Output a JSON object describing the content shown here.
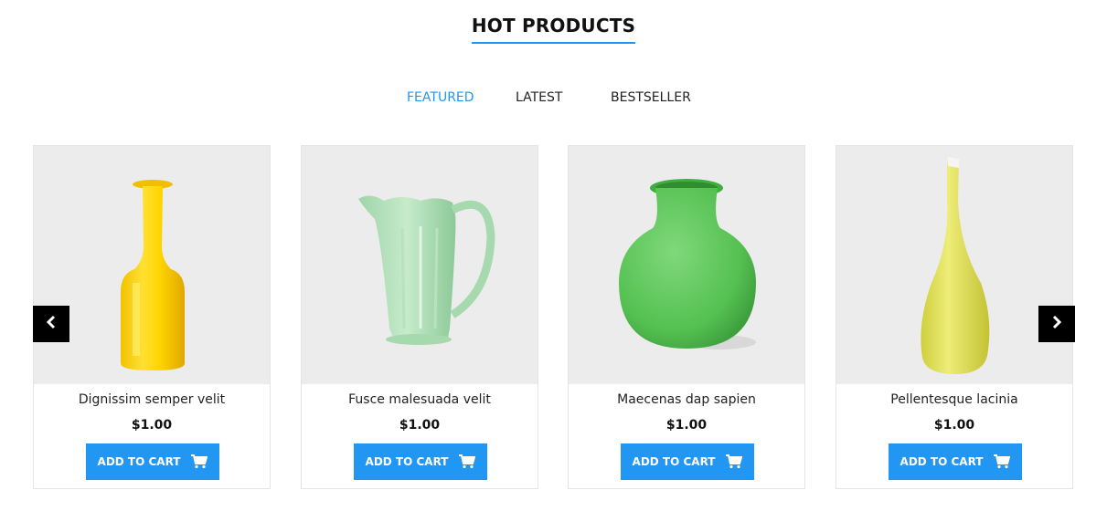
{
  "section": {
    "title": "HOT PRODUCTS"
  },
  "tabs": [
    {
      "label": "FEATURED",
      "active": true
    },
    {
      "label": "LATEST",
      "active": false
    },
    {
      "label": "BESTSELLER",
      "active": false
    }
  ],
  "products": [
    {
      "name": "Dignissim semper velit",
      "price": "$1.00",
      "cart_label": "ADD TO CART",
      "image": "yellow-bottle-vase"
    },
    {
      "name": "Fusce malesuada velit",
      "price": "$1.00",
      "cart_label": "ADD TO CART",
      "image": "green-glass-pitcher"
    },
    {
      "name": "Maecenas dap sapien",
      "price": "$1.00",
      "cart_label": "ADD TO CART",
      "image": "green-round-vase"
    },
    {
      "name": "Pellentesque lacinia",
      "price": "$1.00",
      "cart_label": "ADD TO CART",
      "image": "yellow-slim-vase"
    }
  ],
  "colors": {
    "accent": "#2196f3",
    "image_bg": "#ececec",
    "arrow_bg": "#000000"
  },
  "icons": {
    "prev": "chevron-left-icon",
    "next": "chevron-right-icon",
    "cart": "shopping-cart-icon"
  }
}
